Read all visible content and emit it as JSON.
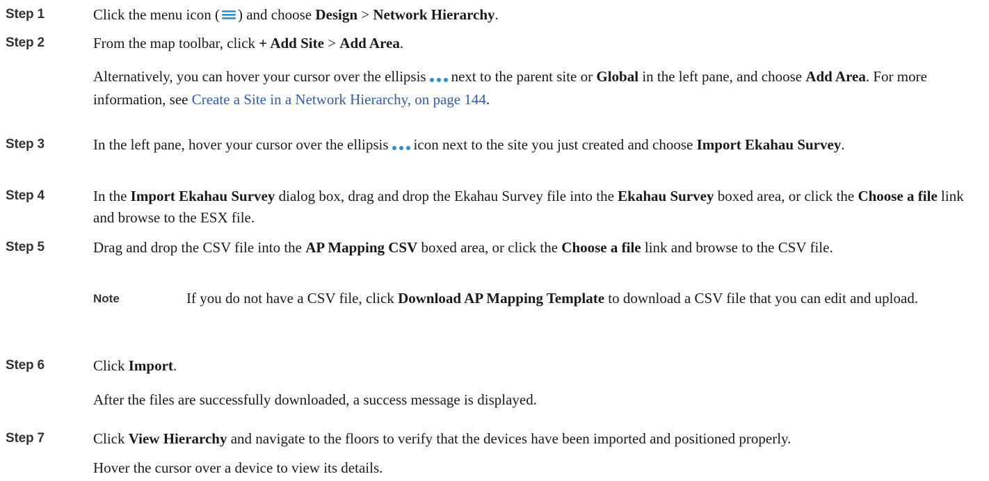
{
  "steps": [
    {
      "label": "Step 1",
      "a": "Click the menu icon (",
      "b": ") and choose ",
      "bold1": "Design",
      "sep": " > ",
      "bold2": "Network Hierarchy",
      "end": "."
    },
    {
      "label": "Step 2",
      "a": "From the map toolbar, click ",
      "bold1": "+ Add Site",
      "sep": " > ",
      "bold2": "Add Area",
      "end": "."
    },
    {
      "label": "Step 3",
      "a": "In the left pane, hover your cursor over the ellipsis",
      "b": "icon next to the site you just created and choose ",
      "bold1": "Import Ekahau Survey",
      "end": "."
    },
    {
      "label": "Step 4",
      "a": "In the ",
      "bold1": "Import Ekahau Survey",
      "b": " dialog box, drag and drop the Ekahau Survey file into the ",
      "bold2": "Ekahau Survey",
      "c": " boxed area, or click the ",
      "bold3": "Choose a file",
      "d": " link and browse to the ESX file."
    },
    {
      "label": "Step 5",
      "a": "Drag and drop the CSV file into the ",
      "bold1": "AP Mapping CSV",
      "b": " boxed area, or click the ",
      "bold2": "Choose a file",
      "c": " link and browse to the CSV file."
    },
    {
      "label": "Step 6",
      "a": "Click ",
      "bold1": "Import",
      "end": "."
    },
    {
      "label": "Step 7",
      "a": "Click ",
      "bold1": "View Hierarchy",
      "b": " and navigate to the floors to verify that the devices have been imported and positioned properly."
    }
  ],
  "step2_alt": {
    "a": "Alternatively, you can hover your cursor over the ellipsis",
    "b": "next to the parent site or ",
    "bold1": "Global",
    "c": " in the left pane, and choose ",
    "bold2": "Add Area",
    "d": ". For more information, see ",
    "link": "Create a Site in a Network Hierarchy, on page 144",
    "end": "."
  },
  "note": {
    "label": "Note",
    "a": "If you do not have a CSV file, click ",
    "bold1": "Download AP Mapping Template",
    "b": " to download a CSV file that you can edit and upload."
  },
  "step6_result": "After the files are successfully downloaded, a success message is displayed.",
  "step7_extra": "Hover the cursor over a device to view its details.",
  "icons": {
    "menu": "menu-icon",
    "ellipsis": "ellipsis-icon"
  },
  "colors": {
    "link": "#2f5bb7",
    "icon": "#2b8fd6"
  }
}
